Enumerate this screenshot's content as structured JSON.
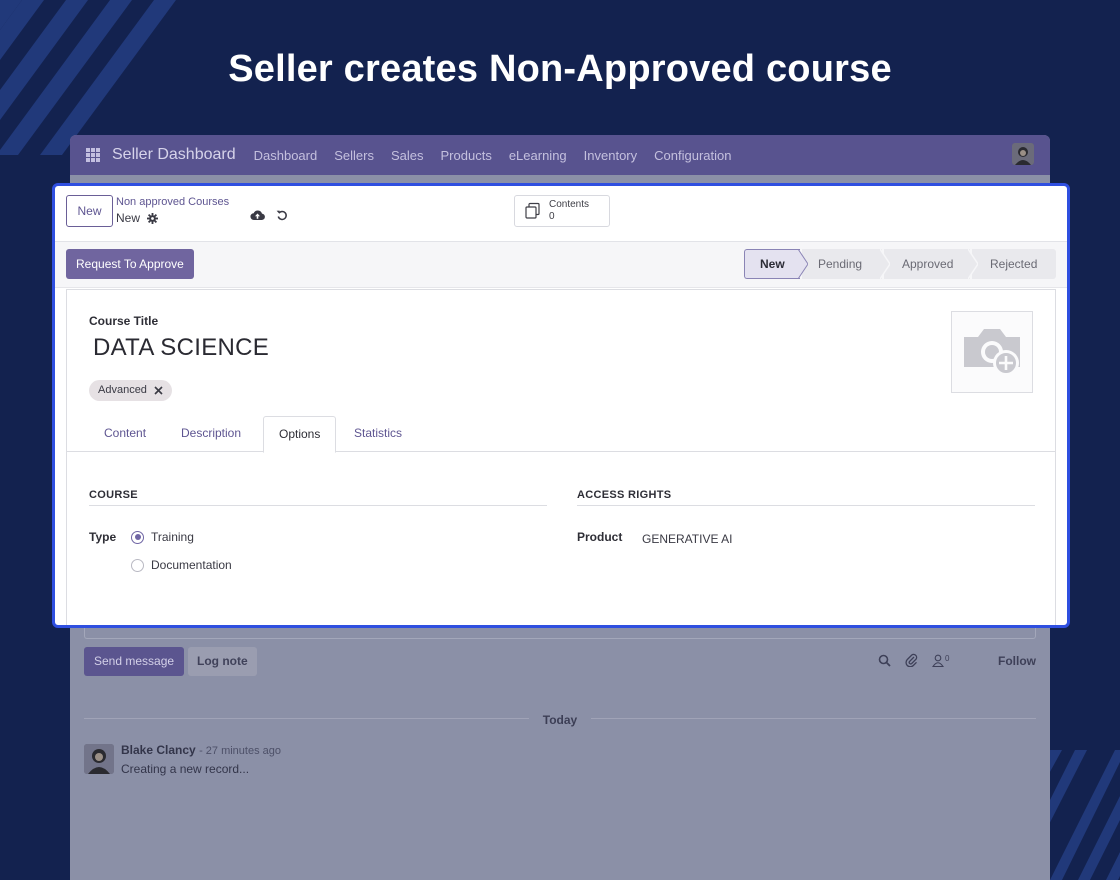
{
  "headline": "Seller creates Non-Approved course",
  "navbar": {
    "brand": "Seller Dashboard",
    "items": [
      "Dashboard",
      "Sellers",
      "Sales",
      "Products",
      "eLearning",
      "Inventory",
      "Configuration"
    ]
  },
  "control_panel": {
    "new_label": "New",
    "breadcrumb_parent": "Non approved Courses",
    "breadcrumb_current": "New",
    "smart_button": {
      "label": "Contents",
      "count": "0"
    }
  },
  "status": {
    "action_label": "Request To Approve",
    "stages": [
      "New",
      "Pending",
      "Approved",
      "Rejected"
    ],
    "current": "New"
  },
  "form": {
    "title_label": "Course Title",
    "title_value": "DATA SCIENCE",
    "tag": "Advanced",
    "tabs": [
      "Content",
      "Description",
      "Options",
      "Statistics"
    ],
    "active_tab": "Options",
    "course_section": "COURSE",
    "type_label": "Type",
    "type_options": [
      "Training",
      "Documentation"
    ],
    "type_selected": "Training",
    "access_section": "ACCESS RIGHTS",
    "product_label": "Product",
    "product_value": "GENERATIVE AI"
  },
  "chatter": {
    "send_label": "Send message",
    "log_label": "Log note",
    "followers_count": "0",
    "follow_label": "Follow",
    "date_divider": "Today",
    "message": {
      "author": "Blake Clancy",
      "time": "- 27 minutes ago",
      "body": "Creating a new record..."
    }
  },
  "colors": {
    "background": "#13224f",
    "highlight": "#2f4fe0",
    "primary": "#70659f"
  }
}
